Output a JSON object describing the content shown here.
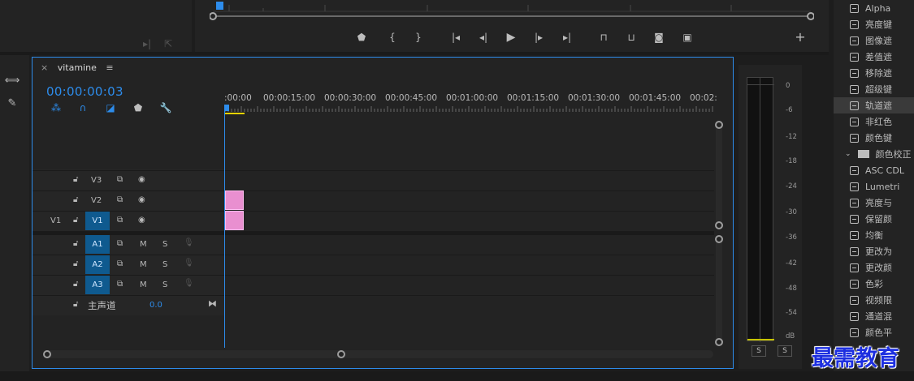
{
  "program_monitor": {
    "controls": [
      "marker-icon",
      "in-point-icon",
      "out-point-icon",
      "go-to-in-icon",
      "step-back-icon",
      "play-icon",
      "step-forward-icon",
      "go-to-out-icon",
      "lift-icon",
      "extract-icon",
      "export-frame-icon",
      "compare-view-icon"
    ],
    "add_button": "+"
  },
  "timeline": {
    "tab_label": "vitamine",
    "timecode": "00:00:00:03",
    "ruler_labels": [
      ":00:00",
      "00:00:15:00",
      "00:00:30:00",
      "00:00:45:00",
      "00:01:00:00",
      "00:01:15:00",
      "00:01:30:00",
      "00:01:45:00",
      "00:02:"
    ],
    "tracks": {
      "v3": "V3",
      "v2": "V2",
      "v1": "V1",
      "v1_source": "V1",
      "a1": "A1",
      "a2": "A2",
      "a3": "A3",
      "mute": "M",
      "solo": "S",
      "master_label": "主声道",
      "master_value": "0.0"
    }
  },
  "meter": {
    "ticks": [
      "0",
      "-6",
      "-12",
      "-18",
      "-24",
      "-30",
      "-36",
      "-42",
      "-48",
      "-54",
      "dB"
    ],
    "solo_left": "S",
    "solo_right": "S"
  },
  "effects": {
    "items": [
      "Alpha",
      "亮度键",
      "图像遮",
      "差值遮",
      "移除遮",
      "超级键",
      "轨道遮",
      "非红色",
      "颜色键"
    ],
    "folder": "颜色校正",
    "folder_items": [
      "ASC CDL",
      "Lumetri",
      "亮度与",
      "保留颜",
      "均衡",
      "更改为",
      "更改颜",
      "色彩",
      "视频限",
      "通道混",
      "颜色平"
    ]
  },
  "watermark": "最需教育",
  "colors": {
    "accent": "#2d8ceb",
    "clip": "#e98fd0",
    "target": "#0f5a8f"
  }
}
